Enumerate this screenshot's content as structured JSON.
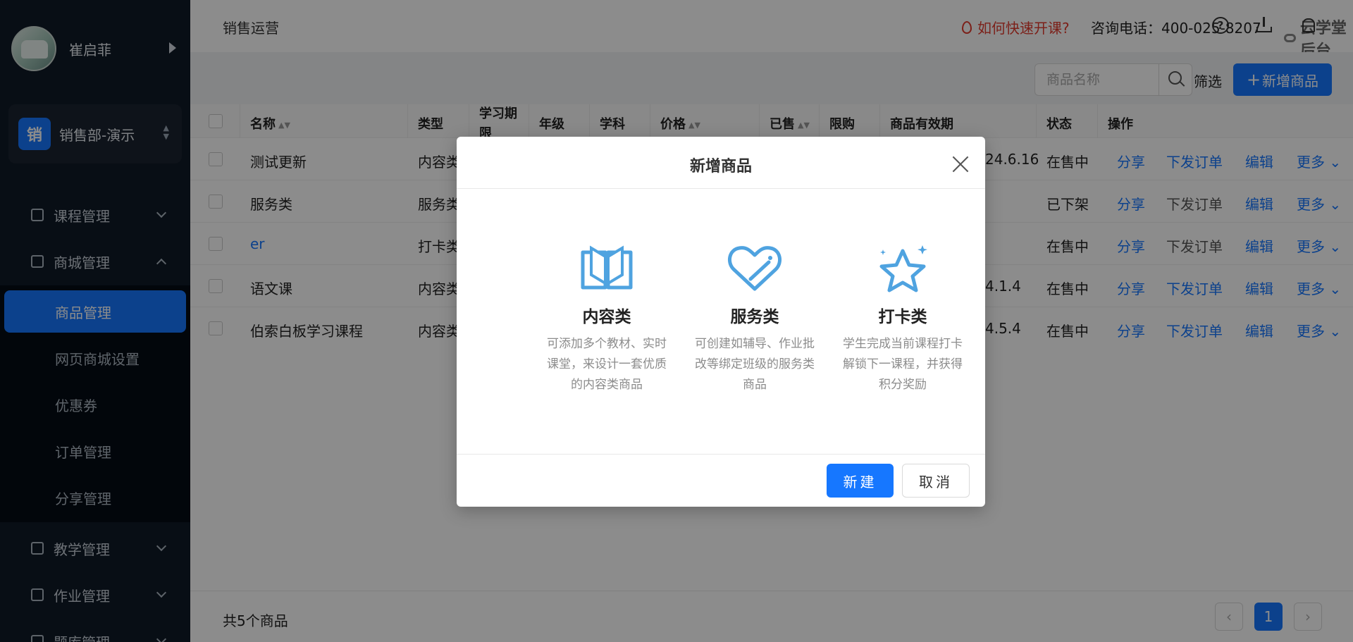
{
  "sidebar": {
    "user_name": "崔启菲",
    "dept_badge": "销",
    "dept_name": "销售部-演示",
    "menu": [
      {
        "label": "课程管理"
      },
      {
        "label": "商城管理"
      },
      {
        "label": "教学管理"
      },
      {
        "label": "作业管理"
      },
      {
        "label": "题库管理"
      }
    ],
    "submenu": [
      {
        "label": "商品管理"
      },
      {
        "label": "网页商城设置"
      },
      {
        "label": "优惠券"
      },
      {
        "label": "订单管理"
      },
      {
        "label": "分享管理"
      }
    ]
  },
  "header": {
    "title": "销售运营",
    "help": "如何快速开课?",
    "phone": "咨询电话：400-025-8207",
    "brand": "云学堂后台",
    "help_icon": "?"
  },
  "toolbar": {
    "search_placeholder": "商品名称",
    "filter": "筛选",
    "add_button": "新增商品",
    "add_plus": "+"
  },
  "table": {
    "columns": [
      "名称",
      "类型",
      "学习期限",
      "年级",
      "学科",
      "价格",
      "已售",
      "限购",
      "商品有效期",
      "状态",
      "操作"
    ],
    "rows": [
      {
        "name": "测试更新",
        "type": "内容类",
        "validity": "24.6.16",
        "status": "在售中",
        "share": "分享",
        "issue": "下发订单",
        "edit": "编辑",
        "more": "更多"
      },
      {
        "name": "服务类",
        "type": "服务类",
        "validity": "",
        "status": "已下架",
        "share": "分享",
        "issue": "下发订单",
        "edit": "编辑",
        "more": "更多"
      },
      {
        "name": "er",
        "type": "打卡类",
        "validity": "",
        "status": "在售中",
        "share": "分享",
        "issue": "下发订单",
        "edit": "编辑",
        "more": "更多"
      },
      {
        "name": "语文课",
        "type": "内容类",
        "validity": "4.1.4",
        "status": "在售中",
        "share": "分享",
        "issue": "下发订单",
        "edit": "编辑",
        "more": "更多"
      },
      {
        "name": "伯索白板学习课程",
        "type": "内容类",
        "validity": "4.5.4",
        "status": "在售中",
        "share": "分享",
        "issue": "下发订单",
        "edit": "编辑",
        "more": "更多"
      }
    ]
  },
  "footer": {
    "total": "共5个商品",
    "current_page": "1",
    "prev": "‹",
    "next": "›"
  },
  "modal": {
    "title": "新增商品",
    "options": [
      {
        "label": "内容类",
        "desc": "可添加多个教材、实时课堂，来设计一套优质的内容类商品",
        "icon": "book-icon"
      },
      {
        "label": "服务类",
        "desc": "可创建如辅导、作业批改等绑定班级的服务类商品",
        "icon": "heart-tag-icon"
      },
      {
        "label": "打卡类",
        "desc": "学生完成当前课程打卡解锁下一课程，并获得积分奖励",
        "icon": "star-icon"
      }
    ],
    "create_button": "新建",
    "cancel_button": "取消"
  },
  "colors": {
    "primary": "#1677ff",
    "sidebar_bg": "#0f1a27",
    "icon_blue": "#4fa3e0",
    "help_red": "#e23b2e"
  }
}
